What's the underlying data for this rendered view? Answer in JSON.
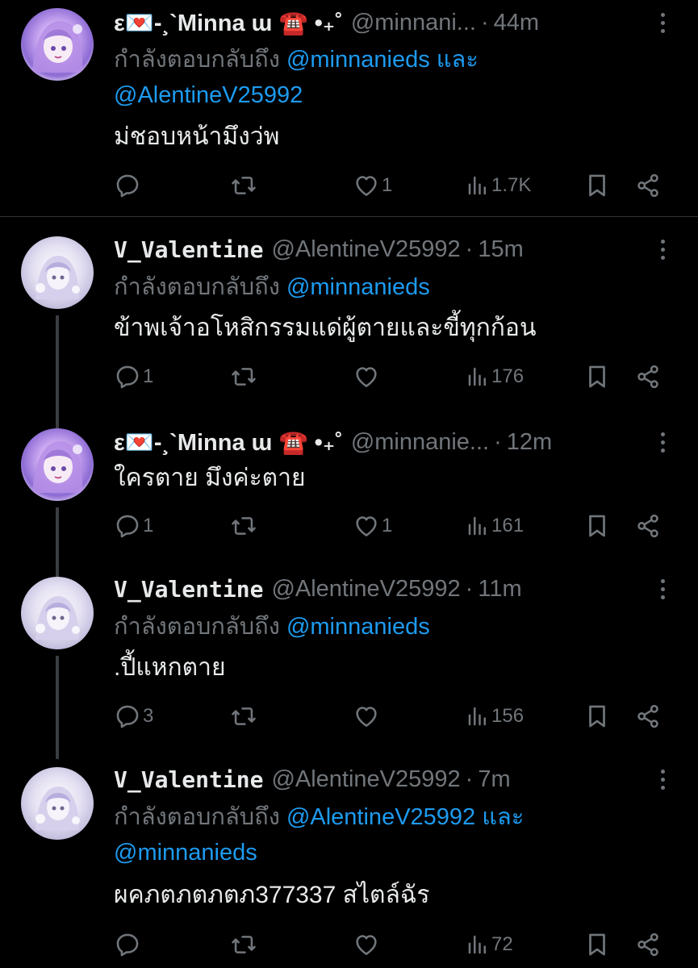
{
  "tweets": [
    {
      "name": "ε💌-¸`Minna ɯ ☎️ •₊˚",
      "handle": "@minnani...",
      "time": "44m",
      "reply_prefix": "กำลังตอบกลับถึง",
      "reply_mention_1": "@minnanieds",
      "reply_and": "และ",
      "reply_mention_2": "@AlentineV25992",
      "text": "ม่ชอบหน้ามึงว่พ",
      "replies": "",
      "retweets": "",
      "likes": "1",
      "views": "1.7K"
    },
    {
      "name": "V_Valentine",
      "handle": "@AlentineV25992",
      "time": "15m",
      "reply_prefix": "กำลังตอบกลับถึง",
      "reply_mention_1": "@minnanieds",
      "text": "ข้าพเจ้าอโหสิกรรมแด่ผู้ตายและขี้ทุกก้อน",
      "replies": "1",
      "retweets": "",
      "likes": "",
      "views": "176"
    },
    {
      "name": "ε💌-¸`Minna ɯ ☎️ •₊˚",
      "handle": "@minnanie...",
      "time": "12m",
      "text": "ใครตาย มึงค่ะตาย",
      "replies": "1",
      "retweets": "",
      "likes": "1",
      "views": "161"
    },
    {
      "name": "V_Valentine",
      "handle": "@AlentineV25992",
      "time": "11m",
      "reply_prefix": "กำลังตอบกลับถึง",
      "reply_mention_1": "@minnanieds",
      "text": ".ปี้แหกตาย",
      "replies": "3",
      "retweets": "",
      "likes": "",
      "views": "156"
    },
    {
      "name": "V_Valentine",
      "handle": "@AlentineV25992",
      "time": "7m",
      "reply_prefix": "กำลังตอบกลับถึง",
      "reply_mention_1": "@AlentineV25992",
      "reply_and": "และ",
      "reply_mention_2": "@minnanieds",
      "text": "ผคภตภตภตภ377337 สไตล์ฉัร",
      "replies": "",
      "retweets": "",
      "likes": "",
      "views": "72"
    }
  ],
  "separator": "·",
  "icons": {
    "reply": "reply-icon",
    "retweet": "retweet-icon",
    "like": "heart-icon",
    "views": "views-icon",
    "bookmark": "bookmark-icon",
    "share": "share-icon",
    "more": "more-icon"
  },
  "colors": {
    "background": "#000000",
    "text": "#e7e9ea",
    "muted": "#71767b",
    "link": "#1d9bf0",
    "thread_line": "#3a3d41"
  }
}
